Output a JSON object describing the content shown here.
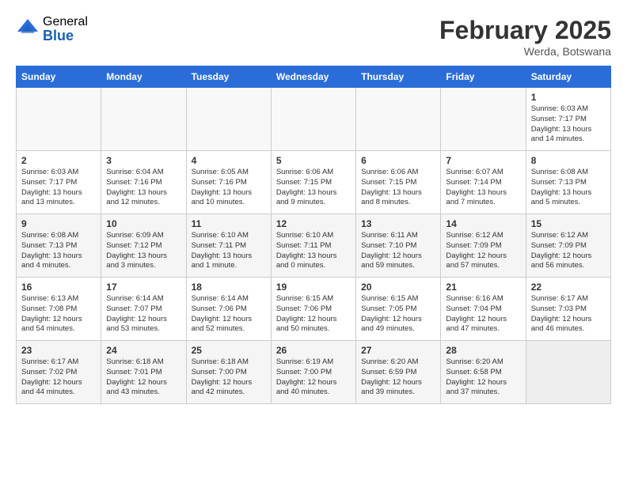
{
  "header": {
    "logo_general": "General",
    "logo_blue": "Blue",
    "month_title": "February 2025",
    "location": "Werda, Botswana"
  },
  "weekdays": [
    "Sunday",
    "Monday",
    "Tuesday",
    "Wednesday",
    "Thursday",
    "Friday",
    "Saturday"
  ],
  "weeks": [
    {
      "alt": false,
      "days": [
        {
          "num": "",
          "info": ""
        },
        {
          "num": "",
          "info": ""
        },
        {
          "num": "",
          "info": ""
        },
        {
          "num": "",
          "info": ""
        },
        {
          "num": "",
          "info": ""
        },
        {
          "num": "",
          "info": ""
        },
        {
          "num": "1",
          "info": "Sunrise: 6:03 AM\nSunset: 7:17 PM\nDaylight: 13 hours\nand 14 minutes."
        }
      ]
    },
    {
      "alt": false,
      "days": [
        {
          "num": "2",
          "info": "Sunrise: 6:03 AM\nSunset: 7:17 PM\nDaylight: 13 hours\nand 13 minutes."
        },
        {
          "num": "3",
          "info": "Sunrise: 6:04 AM\nSunset: 7:16 PM\nDaylight: 13 hours\nand 12 minutes."
        },
        {
          "num": "4",
          "info": "Sunrise: 6:05 AM\nSunset: 7:16 PM\nDaylight: 13 hours\nand 10 minutes."
        },
        {
          "num": "5",
          "info": "Sunrise: 6:06 AM\nSunset: 7:15 PM\nDaylight: 13 hours\nand 9 minutes."
        },
        {
          "num": "6",
          "info": "Sunrise: 6:06 AM\nSunset: 7:15 PM\nDaylight: 13 hours\nand 8 minutes."
        },
        {
          "num": "7",
          "info": "Sunrise: 6:07 AM\nSunset: 7:14 PM\nDaylight: 13 hours\nand 7 minutes."
        },
        {
          "num": "8",
          "info": "Sunrise: 6:08 AM\nSunset: 7:13 PM\nDaylight: 13 hours\nand 5 minutes."
        }
      ]
    },
    {
      "alt": true,
      "days": [
        {
          "num": "9",
          "info": "Sunrise: 6:08 AM\nSunset: 7:13 PM\nDaylight: 13 hours\nand 4 minutes."
        },
        {
          "num": "10",
          "info": "Sunrise: 6:09 AM\nSunset: 7:12 PM\nDaylight: 13 hours\nand 3 minutes."
        },
        {
          "num": "11",
          "info": "Sunrise: 6:10 AM\nSunset: 7:11 PM\nDaylight: 13 hours\nand 1 minute."
        },
        {
          "num": "12",
          "info": "Sunrise: 6:10 AM\nSunset: 7:11 PM\nDaylight: 13 hours\nand 0 minutes."
        },
        {
          "num": "13",
          "info": "Sunrise: 6:11 AM\nSunset: 7:10 PM\nDaylight: 12 hours\nand 59 minutes."
        },
        {
          "num": "14",
          "info": "Sunrise: 6:12 AM\nSunset: 7:09 PM\nDaylight: 12 hours\nand 57 minutes."
        },
        {
          "num": "15",
          "info": "Sunrise: 6:12 AM\nSunset: 7:09 PM\nDaylight: 12 hours\nand 56 minutes."
        }
      ]
    },
    {
      "alt": false,
      "days": [
        {
          "num": "16",
          "info": "Sunrise: 6:13 AM\nSunset: 7:08 PM\nDaylight: 12 hours\nand 54 minutes."
        },
        {
          "num": "17",
          "info": "Sunrise: 6:14 AM\nSunset: 7:07 PM\nDaylight: 12 hours\nand 53 minutes."
        },
        {
          "num": "18",
          "info": "Sunrise: 6:14 AM\nSunset: 7:06 PM\nDaylight: 12 hours\nand 52 minutes."
        },
        {
          "num": "19",
          "info": "Sunrise: 6:15 AM\nSunset: 7:06 PM\nDaylight: 12 hours\nand 50 minutes."
        },
        {
          "num": "20",
          "info": "Sunrise: 6:15 AM\nSunset: 7:05 PM\nDaylight: 12 hours\nand 49 minutes."
        },
        {
          "num": "21",
          "info": "Sunrise: 6:16 AM\nSunset: 7:04 PM\nDaylight: 12 hours\nand 47 minutes."
        },
        {
          "num": "22",
          "info": "Sunrise: 6:17 AM\nSunset: 7:03 PM\nDaylight: 12 hours\nand 46 minutes."
        }
      ]
    },
    {
      "alt": true,
      "days": [
        {
          "num": "23",
          "info": "Sunrise: 6:17 AM\nSunset: 7:02 PM\nDaylight: 12 hours\nand 44 minutes."
        },
        {
          "num": "24",
          "info": "Sunrise: 6:18 AM\nSunset: 7:01 PM\nDaylight: 12 hours\nand 43 minutes."
        },
        {
          "num": "25",
          "info": "Sunrise: 6:18 AM\nSunset: 7:00 PM\nDaylight: 12 hours\nand 42 minutes."
        },
        {
          "num": "26",
          "info": "Sunrise: 6:19 AM\nSunset: 7:00 PM\nDaylight: 12 hours\nand 40 minutes."
        },
        {
          "num": "27",
          "info": "Sunrise: 6:20 AM\nSunset: 6:59 PM\nDaylight: 12 hours\nand 39 minutes."
        },
        {
          "num": "28",
          "info": "Sunrise: 6:20 AM\nSunset: 6:58 PM\nDaylight: 12 hours\nand 37 minutes."
        },
        {
          "num": "",
          "info": ""
        }
      ]
    }
  ]
}
